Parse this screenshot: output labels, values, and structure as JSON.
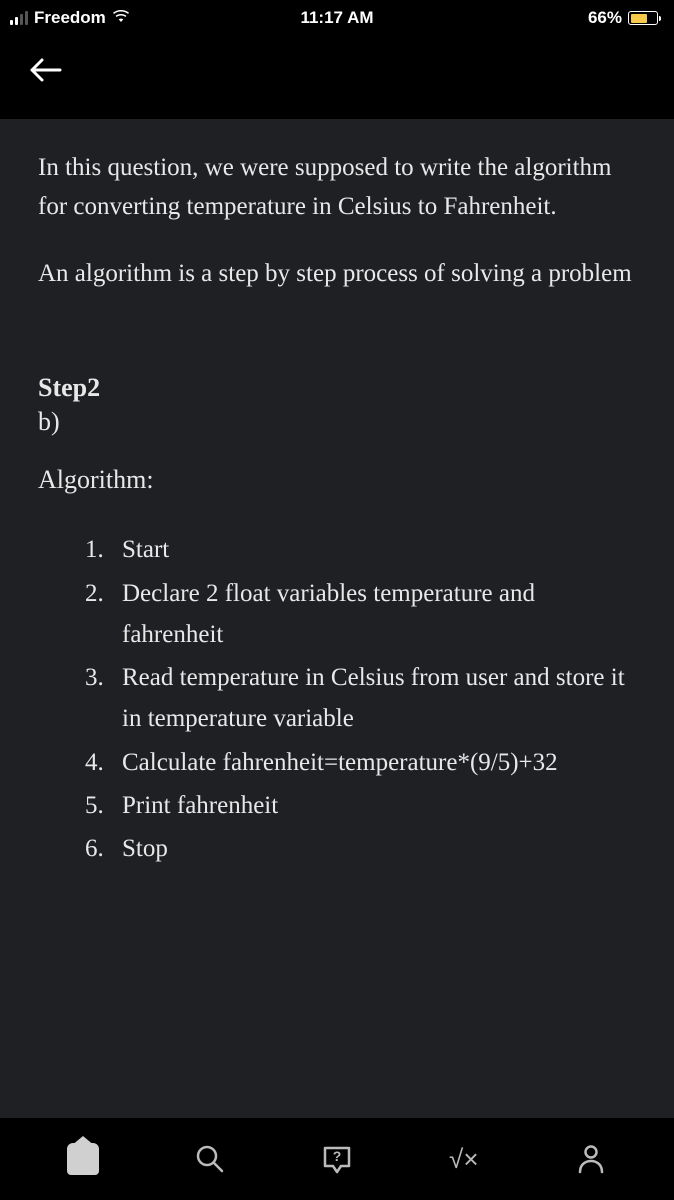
{
  "status": {
    "carrier": "Freedom",
    "time": "11:17 AM",
    "battery": "66%"
  },
  "content": {
    "intro_p1": "In this question, we were supposed to write the algorithm for converting temperature in Celsius to Fahrenheit.",
    "intro_p2": "An algorithm is a step by step process of solving a problem",
    "step_header": "Step2",
    "step_sub": "b)",
    "algo_label": "Algorithm:",
    "steps": [
      "Start",
      "Declare 2 float variables temperature and fahrenheit",
      "Read temperature in Celsius from user and store it in temperature variable",
      "Calculate fahrenheit=temperature*(9/5)+32",
      "Print fahrenheit",
      "Stop"
    ]
  },
  "nav": {
    "math": "√×"
  }
}
